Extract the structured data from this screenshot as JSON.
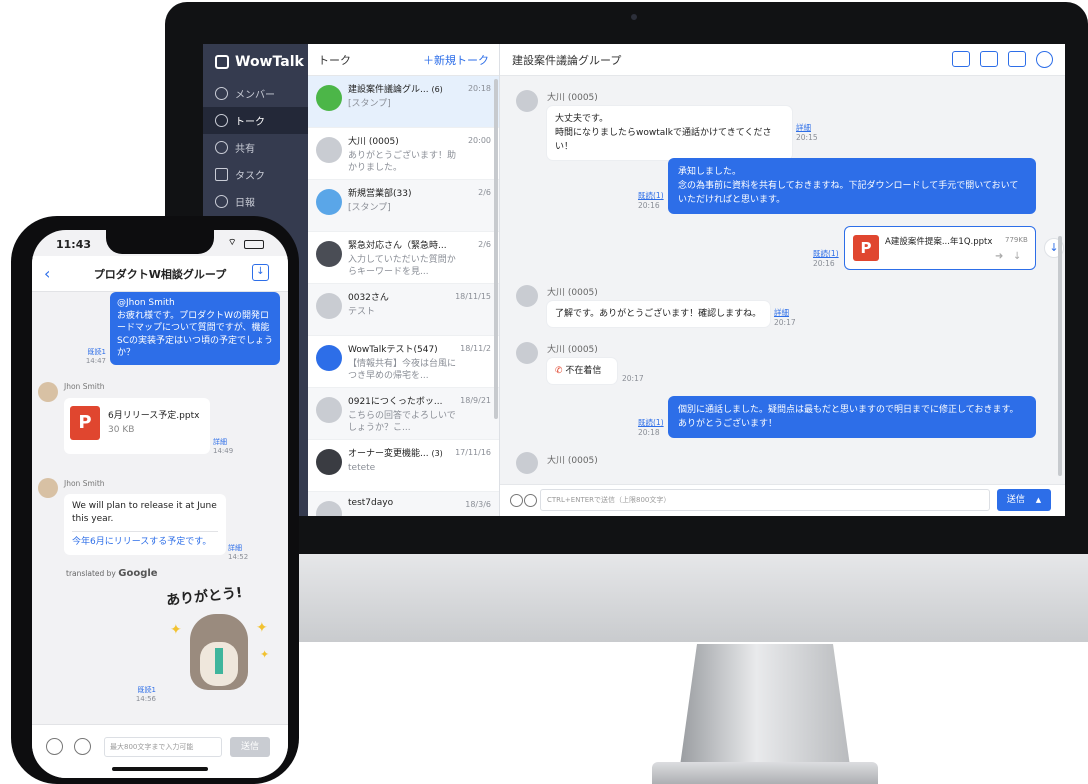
{
  "desktop": {
    "app_name": "WowTalk",
    "nav": [
      {
        "label": "メンバー",
        "icon": "members-icon"
      },
      {
        "label": "トーク",
        "icon": "talk-icon",
        "active": true
      },
      {
        "label": "共有",
        "icon": "share-icon"
      },
      {
        "label": "タスク",
        "icon": "task-icon"
      },
      {
        "label": "日報",
        "icon": "daily-report-icon"
      }
    ],
    "talk_list": {
      "title": "トーク",
      "new_talk": "＋新規トーク",
      "items": [
        {
          "name": "建設案件議論グル...",
          "count": "(6)",
          "preview": "[スタンプ]",
          "time": "20:18"
        },
        {
          "name": "大川 (0005)",
          "count": "",
          "preview": "ありがとうございます！助かりました。",
          "time": "20:00"
        },
        {
          "name": "新規営業部(33)",
          "count": "",
          "preview": "[スタンプ]",
          "time": "2/6"
        },
        {
          "name": "緊急対応さん（緊急時...",
          "count": "",
          "preview": "入力していただいた質問からキーワードを見...",
          "time": "2/6"
        },
        {
          "name": "0032さん",
          "count": "",
          "preview": "テスト",
          "time": "18/11/15"
        },
        {
          "name": "WowTalkテスト(547)",
          "count": "",
          "preview": "【情報共有】今夜は台風につき早めの帰宅を...",
          "time": "18/11/2"
        },
        {
          "name": "0921につくったボッ...",
          "count": "",
          "preview": "こちらの回答でよろしいでしょうか？こ...",
          "time": "18/9/21"
        },
        {
          "name": "オーナー変更機能...",
          "count": "(3)",
          "preview": "tetete",
          "time": "17/11/16"
        },
        {
          "name": "test7dayo",
          "count": "",
          "preview": "",
          "time": "18/3/6"
        }
      ]
    },
    "chat": {
      "title": "建設案件議論グループ",
      "messages": {
        "m1_name": "大川 (0005)",
        "m1_text1": "大丈夫です。",
        "m1_text2": "時間になりましたらwowtalkで通話かけてきてください！",
        "m1_meta": "詳細",
        "m1_time": "20:15",
        "m2_text1": "承知しました。",
        "m2_text2": "念の為事前に資料を共有しておきますね。下記ダウンロードして手元で開いておいて",
        "m2_text3": "いただければと思います。",
        "m2_read": "既読(1)",
        "m2_time": "20:16",
        "m3_file": "A建設案件提案...年1Q.pptx",
        "m3_size": "779KB",
        "m3_read": "既読(1)",
        "m3_time": "20:16",
        "m4_name": "大川 (0005)",
        "m4_text": "了解です。ありがとうございます！確認しますね。",
        "m4_meta": "詳細",
        "m4_time": "20:17",
        "m5_name": "大川 (0005)",
        "m5_text": "不在着信",
        "m5_time": "20:17",
        "m6_text1": "個別に通話しました。疑問点は最もだと思いますので明日までに修正しておきます。",
        "m6_text2": "ありがとうございます！",
        "m6_read": "既読(1)",
        "m6_time": "20:18",
        "m7_name": "大川 (0005)"
      },
      "input_placeholder": "CTRL+ENTERで送信（上限800文字）",
      "send_label": "送信"
    }
  },
  "phone": {
    "status_time": "11:43",
    "title": "プロダクトW相談グループ",
    "msg1": {
      "mention": "@Jhon Smith",
      "text": "お疲れ様です。プロダクトWの開発ロードマップについて質問ですが、機能SCの実装予定はいつ頃の予定でしょうか？",
      "read": "既読1",
      "time": "14:47"
    },
    "msg2": {
      "sender": "Jhon Smith",
      "file": "6月リリース予定.pptx",
      "size": "30 KB",
      "meta": "詳細",
      "time": "14:49"
    },
    "msg3": {
      "sender": "Jhon Smith",
      "text": "We will plan to release it at June this year.",
      "translation": "今年6月にリリースする予定です。",
      "meta": "詳細",
      "time": "14:52"
    },
    "translated_by": "translated by",
    "google": "Google",
    "sticker_text": "ありがとう!",
    "msg4": {
      "read": "既読1",
      "time": "14:56"
    },
    "input_placeholder": "最大800文字まで入力可能",
    "send_label": "送信"
  },
  "colors": {
    "accent": "#2d6ee8",
    "sidebar": "#353b4f",
    "ppt": "#e0462f"
  }
}
